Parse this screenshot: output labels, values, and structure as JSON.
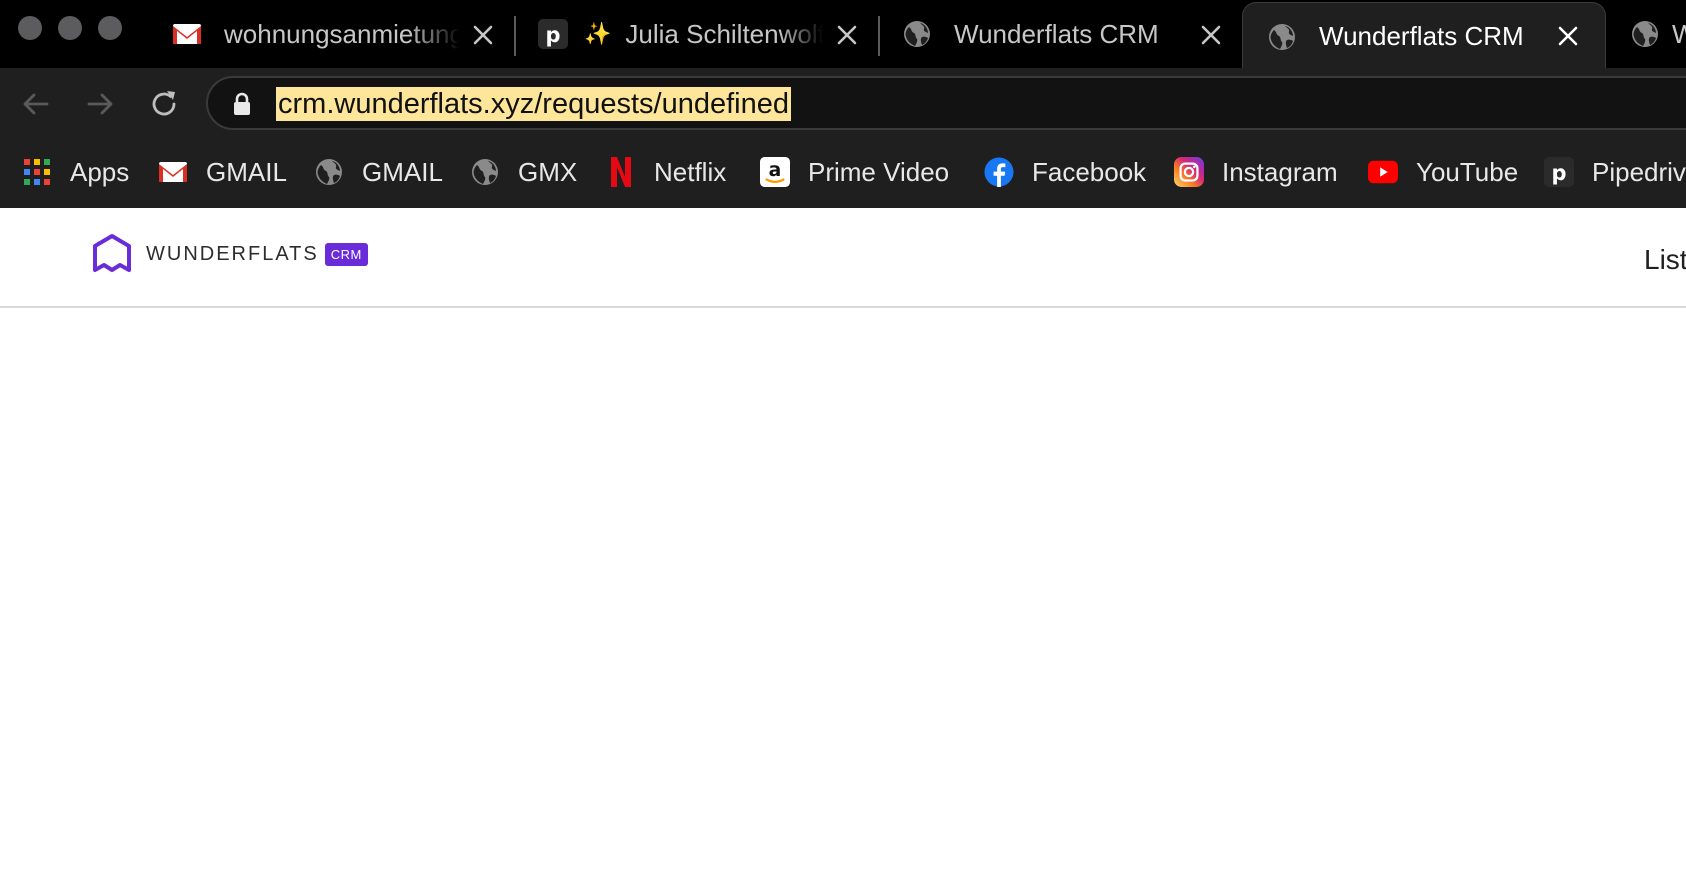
{
  "tabs": [
    {
      "title": "wohnungsanmietung",
      "favicon": "gmail-icon",
      "active": false
    },
    {
      "title": "Julia Schiltenwolf",
      "favicon": "pipedrive-icon",
      "prefix": "✨",
      "active": false
    },
    {
      "title": "Wunderflats CRM",
      "favicon": "globe-icon",
      "active": false
    },
    {
      "title": "Wunderflats CRM",
      "favicon": "globe-icon",
      "active": true
    },
    {
      "title": "W",
      "favicon": "globe-icon",
      "active": false
    }
  ],
  "omnibox": {
    "url": "crm.wunderflats.xyz/requests/undefined"
  },
  "bookmarks": [
    {
      "label": "Apps",
      "icon": "apps-grid-icon"
    },
    {
      "label": "GMAIL",
      "icon": "gmail-icon"
    },
    {
      "label": "GMAIL",
      "icon": "globe-icon"
    },
    {
      "label": "GMX",
      "icon": "globe-icon"
    },
    {
      "label": "Netflix",
      "icon": "netflix-icon"
    },
    {
      "label": "Prime Video",
      "icon": "amazon-icon"
    },
    {
      "label": "Facebook",
      "icon": "facebook-icon"
    },
    {
      "label": "Instagram",
      "icon": "instagram-icon"
    },
    {
      "label": "YouTube",
      "icon": "youtube-icon"
    },
    {
      "label": "Pipedrive",
      "icon": "pipedrive-icon"
    }
  ],
  "site": {
    "logo_text": "WUNDERFLATS",
    "badge": "CRM",
    "nav_item": "List",
    "brand_color": "#6a2bd9"
  }
}
